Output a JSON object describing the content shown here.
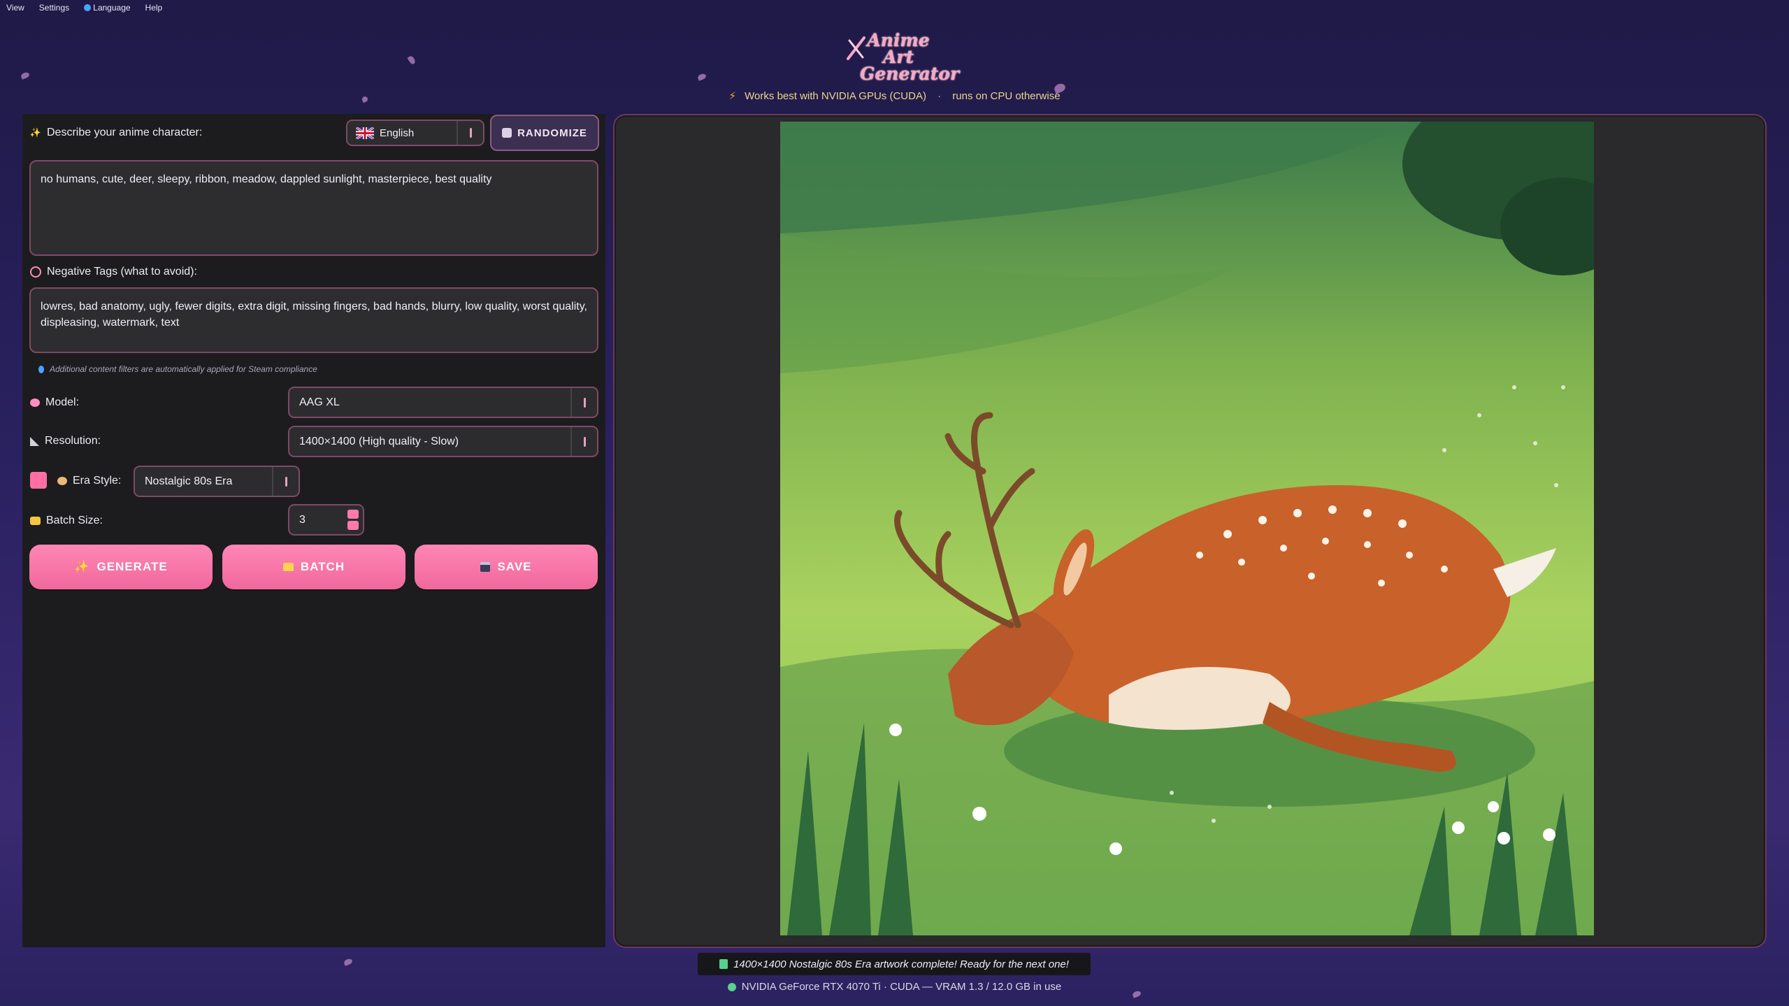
{
  "menu": [
    {
      "label": "View",
      "icon": ""
    },
    {
      "label": "Settings",
      "icon": ""
    },
    {
      "label": "Language",
      "icon": "globe-icon"
    },
    {
      "label": "Help",
      "icon": ""
    }
  ],
  "logo": {
    "line1": "Anime Art",
    "line2": "Generator"
  },
  "banner": {
    "gpu_hint": "Works best with NVIDIA GPUs (CUDA)",
    "separator": "·",
    "cpu_hint": "runs on CPU otherwise"
  },
  "prompt": {
    "label": "Describe your anime character:",
    "value": "no humans, cute, deer, sleepy, ribbon, meadow, dappled sunlight, masterpiece, best quality"
  },
  "language_select": {
    "value": "English",
    "flag_icon": "uk-flag-icon"
  },
  "randomize_label": "RANDOMIZE",
  "negative": {
    "label": "Negative Tags (what to avoid):",
    "value": "lowres, bad anatomy, ugly, fewer digits, extra digit, missing fingers, bad hands, blurry, low quality, worst quality, displeasing, watermark, text"
  },
  "compliance_note": "Additional content filters are automatically applied for Steam compliance",
  "model": {
    "label": "Model:",
    "value": "AAG XL"
  },
  "resolution": {
    "label": "Resolution:",
    "value": "1400×1400 (High quality - Slow)"
  },
  "era": {
    "label": "Era Style:",
    "value": "Nostalgic 80s Era",
    "swatch_color": "#ff6fa3"
  },
  "batch_size": {
    "label": "Batch Size:",
    "value": "3"
  },
  "actions": {
    "generate": "GENERATE",
    "batch": "BATCH",
    "save": "SAVE"
  },
  "status_message": "1400×1400 Nostalgic 80s Era artwork complete! Ready for the next one!",
  "gpu_status": "NVIDIA GeForce RTX 4070 Ti · CUDA — VRAM 1.3 / 12.0 GB in use",
  "colors": {
    "accent": "#ff7aaa",
    "border": "#7e4a66",
    "panel": "#1c1c1e",
    "status_ok": "#57d18e"
  }
}
